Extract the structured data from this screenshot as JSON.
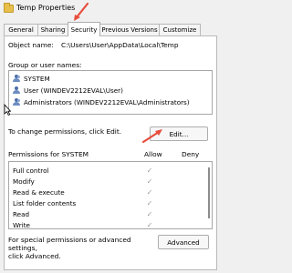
{
  "window": {
    "title": "Temp Properties"
  },
  "tabs": [
    {
      "label": "General"
    },
    {
      "label": "Sharing"
    },
    {
      "label": "Security"
    },
    {
      "label": "Previous Versions"
    },
    {
      "label": "Customize"
    }
  ],
  "object": {
    "label": "Object name:",
    "value": "C:\\Users\\User\\AppData\\Local\\Temp"
  },
  "groups": {
    "label": "Group or user names:",
    "items": [
      {
        "label": "SYSTEM"
      },
      {
        "label": "User (WINDEV2212EVAL\\User)"
      },
      {
        "label": "Administrators (WINDEV2212EVAL\\Administrators)"
      }
    ]
  },
  "change_permissions": {
    "text": "To change permissions, click Edit.",
    "button": "Edit..."
  },
  "permissions": {
    "header": "Permissions for SYSTEM",
    "allow_label": "Allow",
    "deny_label": "Deny",
    "rows": [
      {
        "label": "Full control",
        "allow": "✓",
        "deny": ""
      },
      {
        "label": "Modify",
        "allow": "✓",
        "deny": ""
      },
      {
        "label": "Read & execute",
        "allow": "✓",
        "deny": ""
      },
      {
        "label": "List folder contents",
        "allow": "✓",
        "deny": ""
      },
      {
        "label": "Read",
        "allow": "✓",
        "deny": ""
      },
      {
        "label": "Write",
        "allow": "✓",
        "deny": ""
      }
    ]
  },
  "advanced": {
    "text_line1": "For special permissions or advanced settings,",
    "text_line2": "click Advanced.",
    "button": "Advanced"
  },
  "colors": {
    "annotation": "#e74c3c"
  }
}
